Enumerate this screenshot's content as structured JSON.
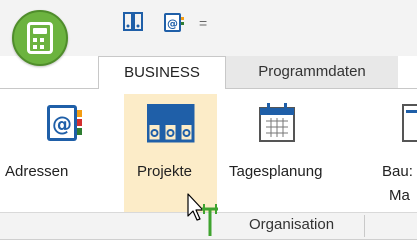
{
  "quick_access": {
    "customize_symbol": "="
  },
  "tabs": [
    {
      "label": "BUSINESS",
      "active": true
    },
    {
      "label": "Programmdaten",
      "active": false
    }
  ],
  "ribbon": {
    "buttons": [
      {
        "label": "Adressen"
      },
      {
        "label": "Projekte",
        "hovered": true
      },
      {
        "label": "Tagesplanung"
      },
      {
        "label_line1": "Bau:",
        "label_line2": "Ma"
      }
    ],
    "group_label": "Organisation"
  },
  "colors": {
    "app_button": "#6cb33f",
    "hover_highlight": "#fcecc8",
    "icon_blue": "#1f5fa8",
    "status_green": "#3fa32f"
  }
}
